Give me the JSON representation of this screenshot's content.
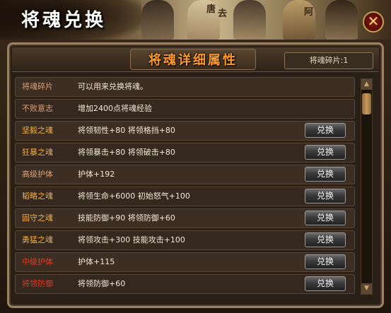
{
  "window": {
    "title": "将魂兑换",
    "close_icon": "close-x-icon"
  },
  "banner": {
    "signs": [
      "唐",
      "去",
      "阿"
    ]
  },
  "panel": {
    "subtitle": "将魂详细属性",
    "fragment_badge": "将魂碎片:1"
  },
  "colors": {
    "gold": "#f2b04a",
    "orange": "#e89a3a",
    "light_orange": "#d8a27a",
    "red": "#e23a22"
  },
  "rows": [
    {
      "name": "将魂碎片",
      "desc": "可以用来兑换将魂。",
      "color": "#d8a27a",
      "button": ""
    },
    {
      "name": "不败意志",
      "desc": "增加2400点将魂经验",
      "color": "#d8a27a",
      "button": ""
    },
    {
      "name": "坚毅之魂",
      "desc": "将领韧性+80    将领格挡+80",
      "color": "#f2b04a",
      "button": "兑换"
    },
    {
      "name": "狂暴之魂",
      "desc": "将领暴击+80    将领破击+80",
      "color": "#f2b04a",
      "button": "兑换"
    },
    {
      "name": "高级护体",
      "desc": "护体+192",
      "color": "#d8a27a",
      "button": "兑换"
    },
    {
      "name": "韬略之魂",
      "desc": "将领生命+6000    初始怒气+100",
      "color": "#f2b04a",
      "button": "兑换"
    },
    {
      "name": "固守之魂",
      "desc": "技能防御+90    将领防御+60",
      "color": "#f2b04a",
      "button": "兑换"
    },
    {
      "name": "勇猛之魂",
      "desc": "将领攻击+300    技能攻击+100",
      "color": "#f2b04a",
      "button": "兑换"
    },
    {
      "name": "中级护体",
      "desc": "护体+115",
      "color": "#e23a22",
      "button": "兑换"
    },
    {
      "name": "将领防御",
      "desc": "将领防御+60",
      "color": "#e23a22",
      "button": "兑换"
    }
  ],
  "scroll": {
    "up_icon": "scroll-up-arrow-icon",
    "down_icon": "scroll-down-arrow-icon"
  }
}
